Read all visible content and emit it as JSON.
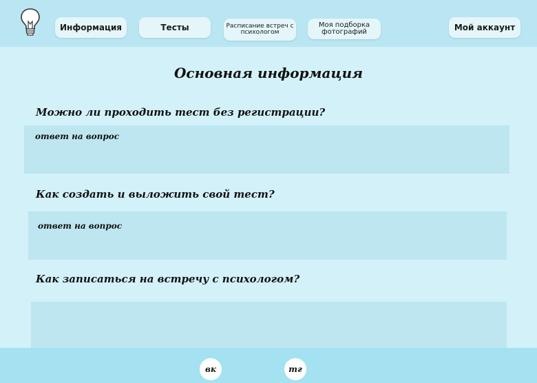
{
  "header": {
    "logo_icon": "lightbulb-icon",
    "nav": {
      "info": "Информация",
      "tests": "Тесты",
      "schedule": [
        "Расписание встреч с",
        "психологом"
      ],
      "photos": [
        "Моя подборка",
        "фотографий"
      ],
      "account": "Мой аккаунт"
    }
  },
  "main": {
    "title": "Основная информация",
    "faq": [
      {
        "question": "Можно ли проходить тест без регистрации?",
        "answer": "ответ на вопрос"
      },
      {
        "question": "Как создать и выложить свой тест?",
        "answer": "ответ на вопрос"
      },
      {
        "question": "Как записаться на встречу с психологом?",
        "answer": ""
      }
    ]
  },
  "footer": {
    "vk": "вк",
    "tg": "тг"
  },
  "colors": {
    "page_bg": "#d3f1f9",
    "header_bg": "#b9e6f2",
    "answer_bg": "#bde6f0",
    "footer_bg": "#a5e2f1",
    "button_bg": "#e4f6fa"
  }
}
